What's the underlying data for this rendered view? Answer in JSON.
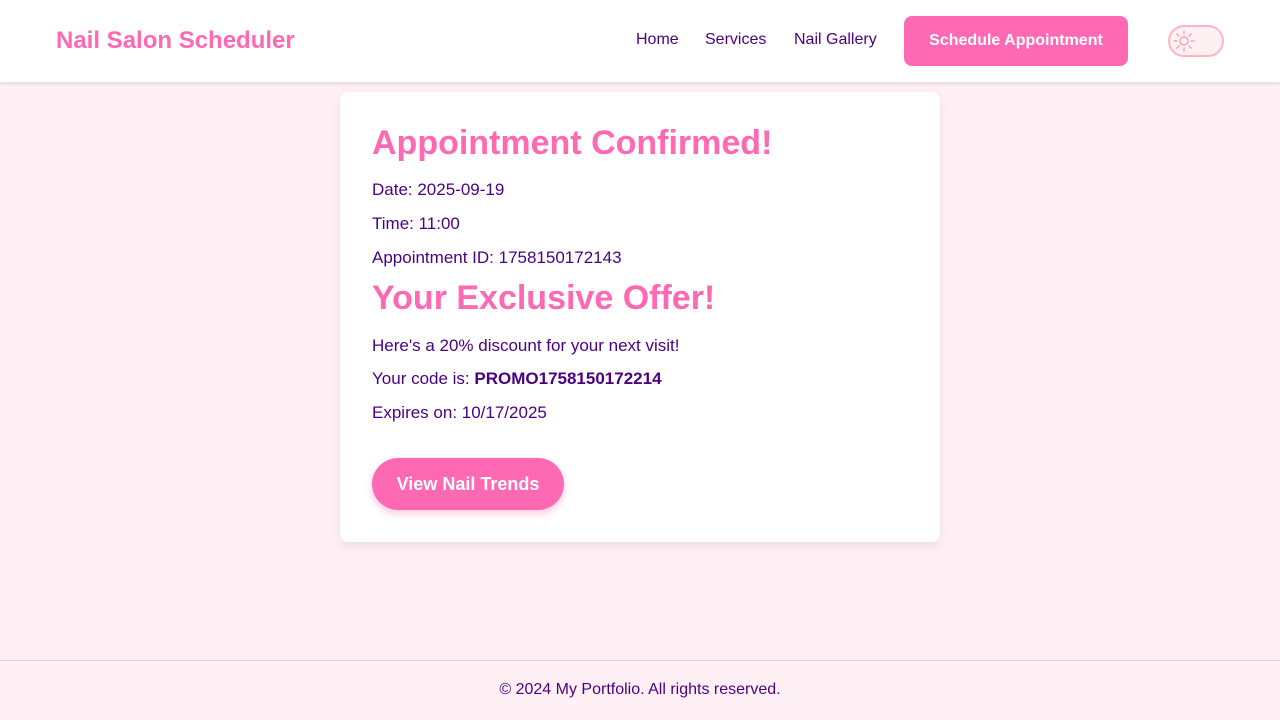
{
  "colors": {
    "accent": "#ff69b4",
    "text": "#4b0082",
    "background": "#fff0f5",
    "card": "#ffffff"
  },
  "header": {
    "brand": "Nail Salon Scheduler",
    "nav": {
      "home": "Home",
      "services": "Services",
      "gallery": "Nail Gallery"
    },
    "cta": "Schedule Appointment",
    "theme_toggle_icon": "sun-icon"
  },
  "confirmation": {
    "title": "Appointment Confirmed!",
    "date_line": "Date: 2025-09-19",
    "time_line": "Time: 11:00",
    "id_line": "Appointment ID: 1758150172143"
  },
  "offer": {
    "title": "Your Exclusive Offer!",
    "discount_line": "Here's a 20% discount for your next visit!",
    "code_label": "Your code is: ",
    "code": "PROMO1758150172214",
    "expires_line": "Expires on: 10/17/2025"
  },
  "actions": {
    "trends_button": "View Nail Trends"
  },
  "footer": {
    "text": "© 2024 My Portfolio. All rights reserved."
  }
}
